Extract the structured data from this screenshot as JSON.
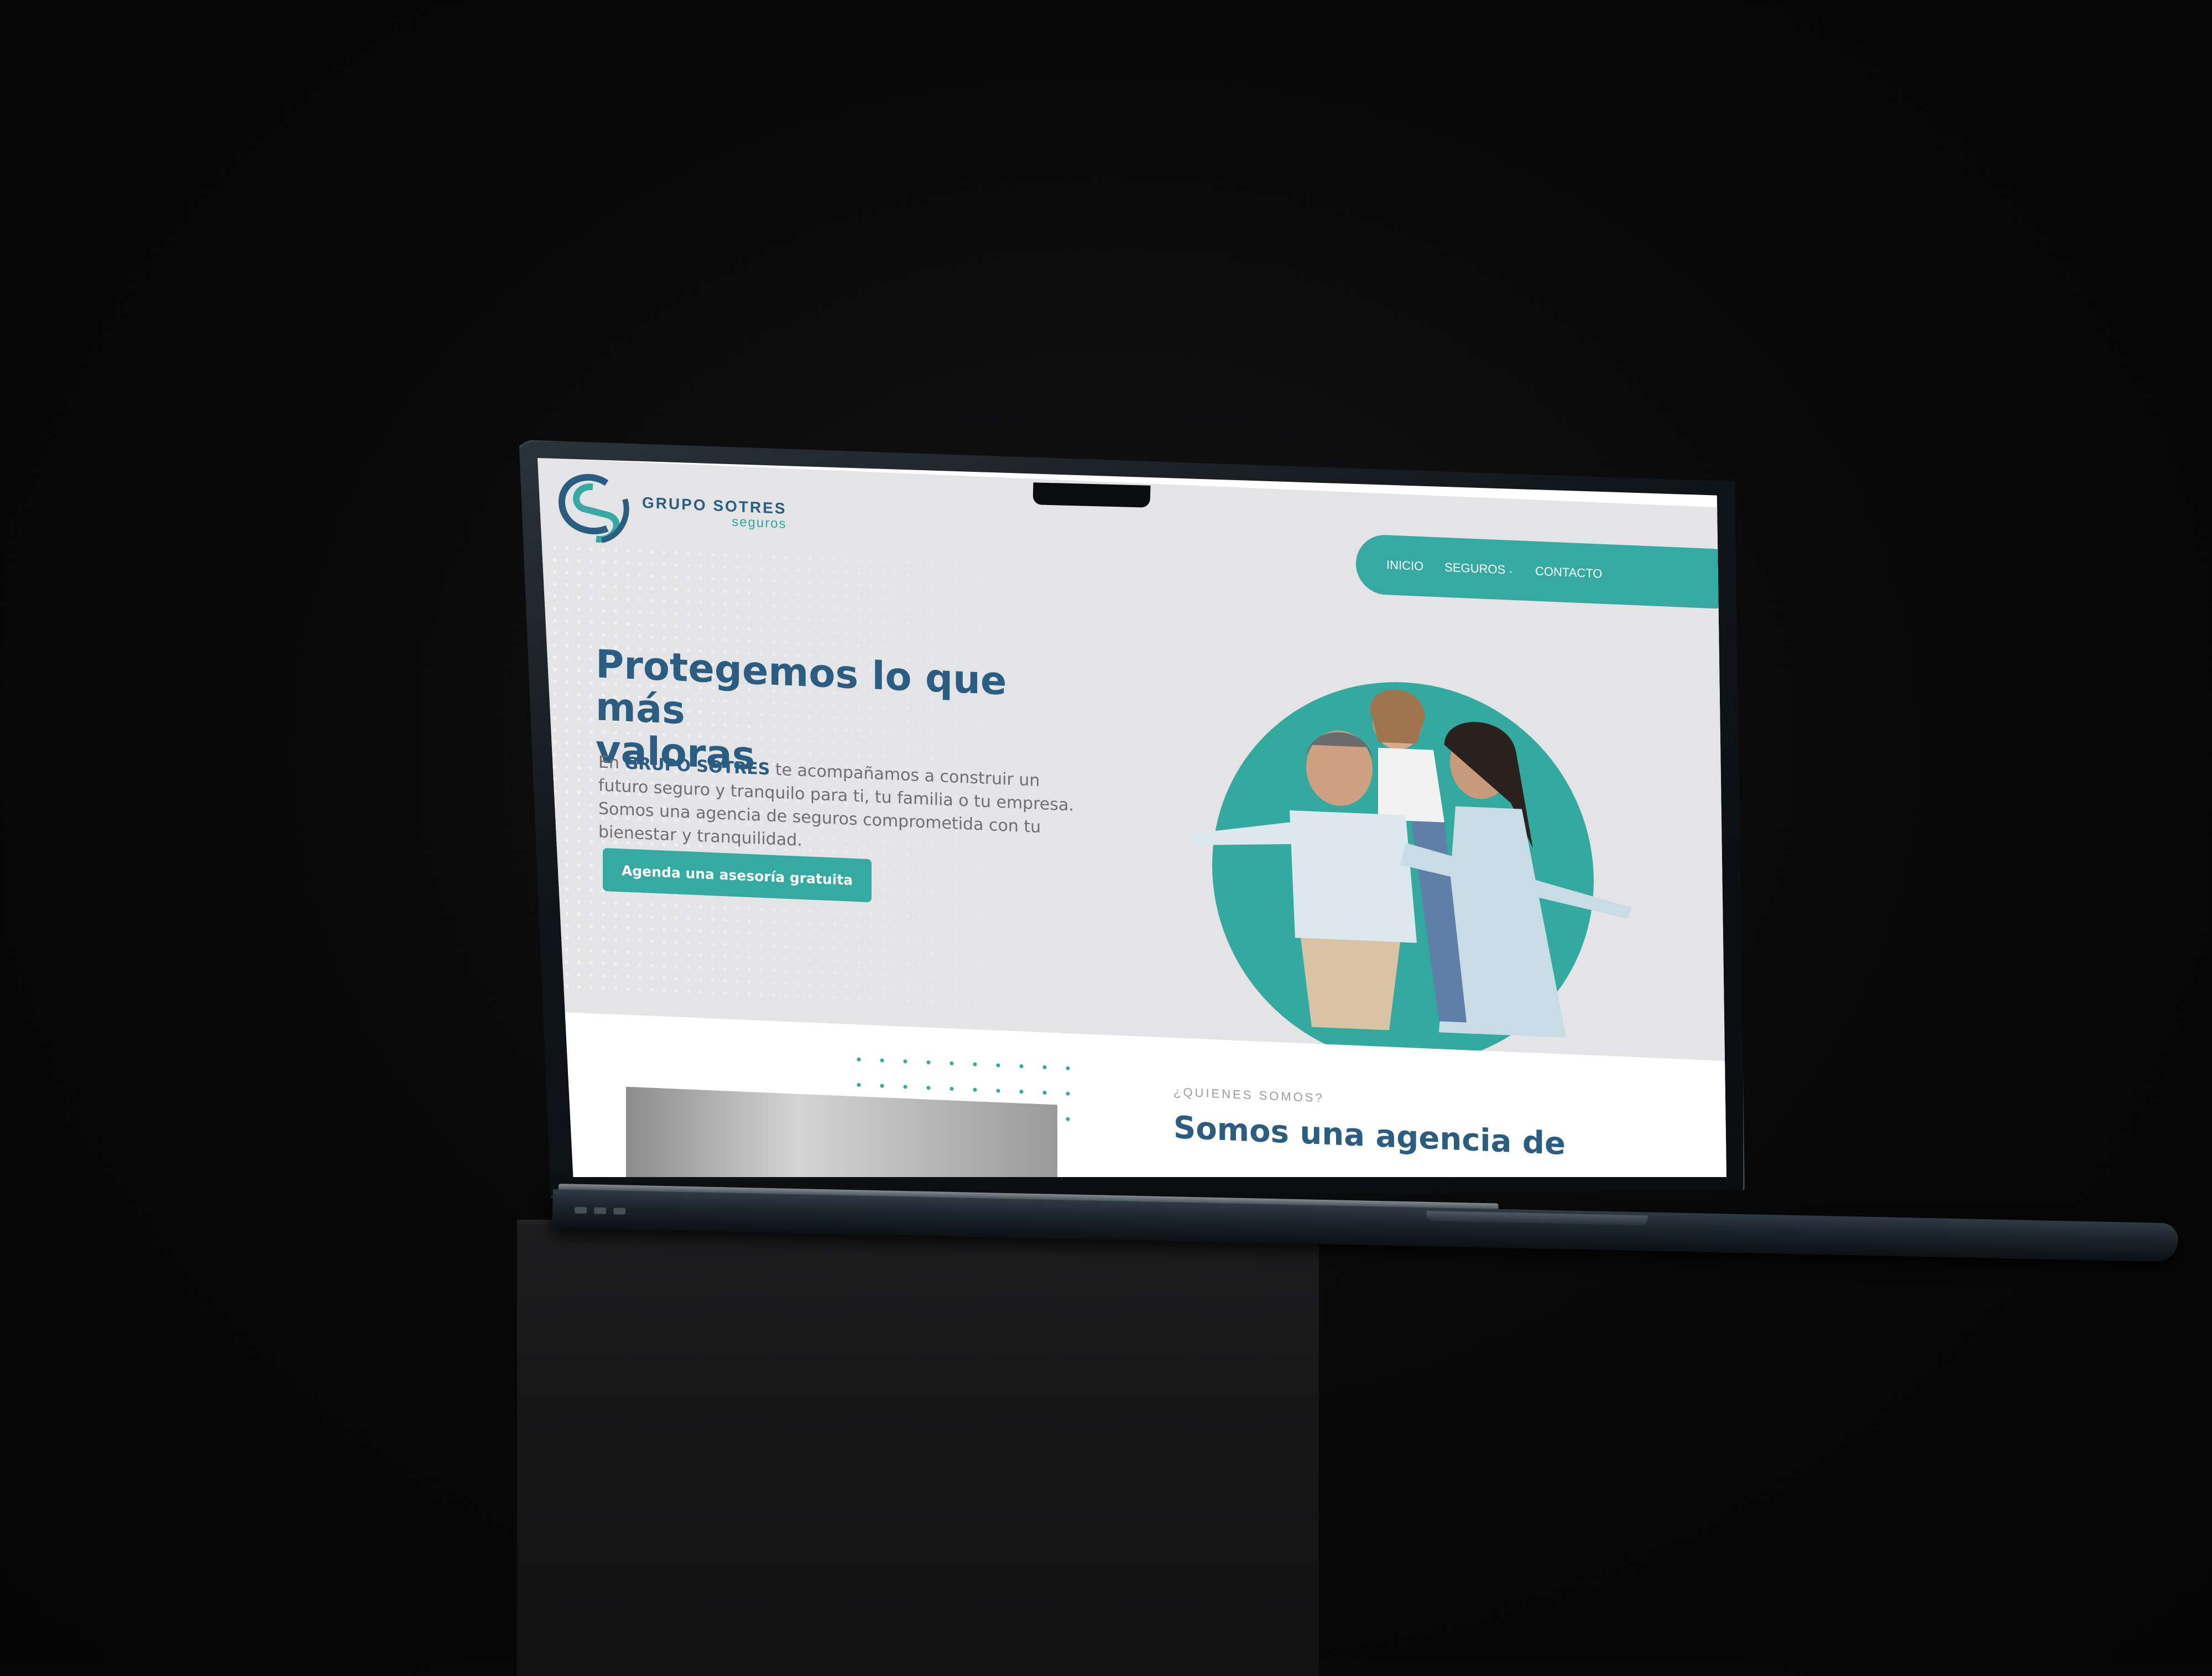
{
  "colors": {
    "primary_teal": "#36a9a2",
    "brand_blue": "#2b5c82",
    "body_gray": "#6d6f73",
    "hero_bg": "#e4e4e6"
  },
  "header": {
    "logo": {
      "icon": "gs-monogram-logo",
      "name": "GRUPO SOTRES",
      "sub": "seguros"
    },
    "nav": {
      "items": [
        {
          "label": "INICIO"
        },
        {
          "label": "SEGUROS",
          "icon": "chevron-down-icon"
        },
        {
          "label": "CONTACTO"
        }
      ]
    }
  },
  "hero": {
    "title_line1": "Protegemos lo que más",
    "title_line2": "valoras",
    "body_prefix": "En ",
    "body_brand": "GRUPO SOTRES",
    "body_rest": " te acompañamos a construir un futuro seguro y tranquilo para ti, tu familia o tu empresa. Somos una agencia de seguros comprometida con tu bienestar y tranquilidad.",
    "cta_label": "Agenda una asesoría gratuita"
  },
  "about": {
    "eyebrow": "¿QUIENES SOMOS?",
    "title": "Somos una agencia de"
  }
}
